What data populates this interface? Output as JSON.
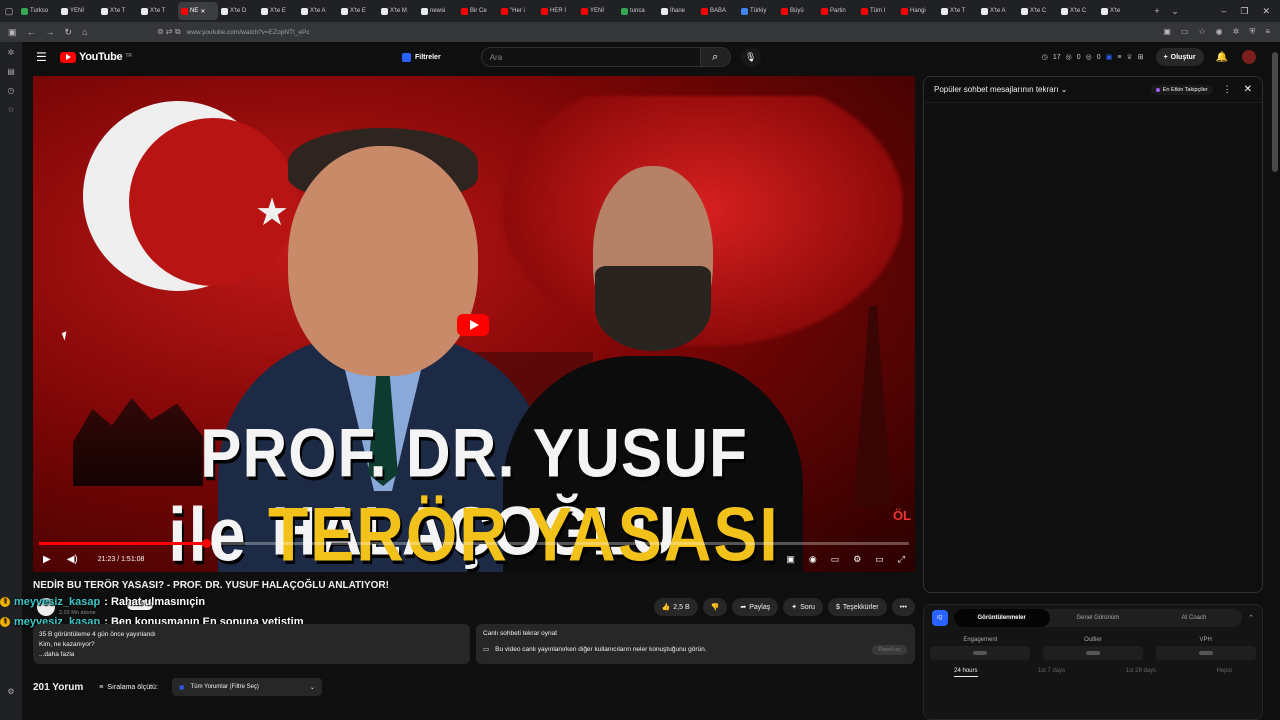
{
  "browser": {
    "tabs": [
      {
        "label": "Turkso",
        "color": "#34a853"
      },
      {
        "label": "YENİ",
        "color": "#e8eaed"
      },
      {
        "label": "X'te T",
        "color": "#e8eaed"
      },
      {
        "label": "X'te T",
        "color": "#e8eaed"
      },
      {
        "label": "NE",
        "color": "#ff0000",
        "active": true
      },
      {
        "label": "X'te D",
        "color": "#e8eaed"
      },
      {
        "label": "X'te E",
        "color": "#e8eaed"
      },
      {
        "label": "X'te A",
        "color": "#e8eaed"
      },
      {
        "label": "X'te E",
        "color": "#e8eaed"
      },
      {
        "label": "X'te M",
        "color": "#e8eaed"
      },
      {
        "label": "newsi",
        "color": "#e8eaed"
      },
      {
        "label": "Bir Ce",
        "color": "#ff0000"
      },
      {
        "label": "\"Her i",
        "color": "#ff0000"
      },
      {
        "label": "HER İ",
        "color": "#ff0000"
      },
      {
        "label": "YENİ",
        "color": "#ff0000"
      },
      {
        "label": "tunca",
        "color": "#34a853"
      },
      {
        "label": "İhane",
        "color": "#e8eaed"
      },
      {
        "label": "BABA",
        "color": "#ff0000"
      },
      {
        "label": "Türkiy",
        "color": "#4285f4"
      },
      {
        "label": "Büyü",
        "color": "#ff0000"
      },
      {
        "label": "Partin",
        "color": "#ff0000"
      },
      {
        "label": "Tüm I",
        "color": "#ff0000"
      },
      {
        "label": "Hangi",
        "color": "#ff0000"
      },
      {
        "label": "X'te T",
        "color": "#e8eaed"
      },
      {
        "label": "X'te A",
        "color": "#e8eaed"
      },
      {
        "label": "X'te C",
        "color": "#e8eaed"
      },
      {
        "label": "X'te C",
        "color": "#e8eaed"
      },
      {
        "label": "X'te",
        "color": "#e8eaed"
      }
    ],
    "url": "www.youtube.com/watch?v=EZopNTt_ePc"
  },
  "header": {
    "logo_text": "YouTube",
    "logo_region": "TR",
    "filter_label": "Filtreler",
    "search_placeholder": "Ara",
    "stats": [
      "17",
      "0",
      "0"
    ],
    "create_label": "Oluştur"
  },
  "video": {
    "thumbnail_line1": "PROF. DR. YUSUF HALAÇOĞLU",
    "thumbnail_line2_a": "ile",
    "thumbnail_line2_b": "TERÖR YASASI",
    "thumbnail_channel_mark": "ÖL",
    "time_display": "21:23 / 1:51:08",
    "progress": 0.1925,
    "title": "NEDİR BU TERÖR YASASI? - PROF. DR. YUSUF HALAÇOĞLU ANLATIYOR!",
    "subscribers": "2,03 Mn abone",
    "join_label": "Katıl",
    "likes": "2,5 B",
    "share_label": "Paylaş",
    "ask_label": "Soru",
    "thanks_label": "Teşekkürler"
  },
  "chat_overlay": [
    {
      "user": "meyvesiz_kasap",
      "message": ": Rahat ulmasınıçin"
    },
    {
      "user": "meyvesiz_kasap",
      "message": ": Ben konuşmanın En sonuna yetiştim"
    }
  ],
  "description": {
    "stats": "35 B görüntüleme  4 gün önce yayınlandı",
    "line1": "Kim, ne kazanıyor?",
    "more": "...daha fazla"
  },
  "replay": {
    "title": "Canlı sohbeti tekrar oynat",
    "text": "Bu video canlı yayınlanırken diğer kullanıcıların neler konuştuğunu görün.",
    "button": "Paneli aç"
  },
  "comments": {
    "count": "201 Yorum",
    "sort_label": "Sıralama ölçütü:",
    "filter_value": "Tüm Yorumlar (Filtre Seç)"
  },
  "chat_panel": {
    "title": "Popüler sohbet mesajlarının tekrarı",
    "top_button": "En Etkin Takipçiler"
  },
  "vidiq": {
    "logo": "IQ",
    "tabs": [
      "Görüntülenmeler",
      "Genel Görünüm",
      "AI Coach"
    ],
    "metrics": [
      "Engagement",
      "Outlier",
      "VPH"
    ],
    "ranges": [
      "24 hours",
      "1st 7 days",
      "1st 28 days",
      "Hepsi"
    ]
  },
  "colors": {
    "accent": "#ff0000",
    "chat_user": "#3ec7c7",
    "thumbnail_yellow": "#f2c21a"
  }
}
